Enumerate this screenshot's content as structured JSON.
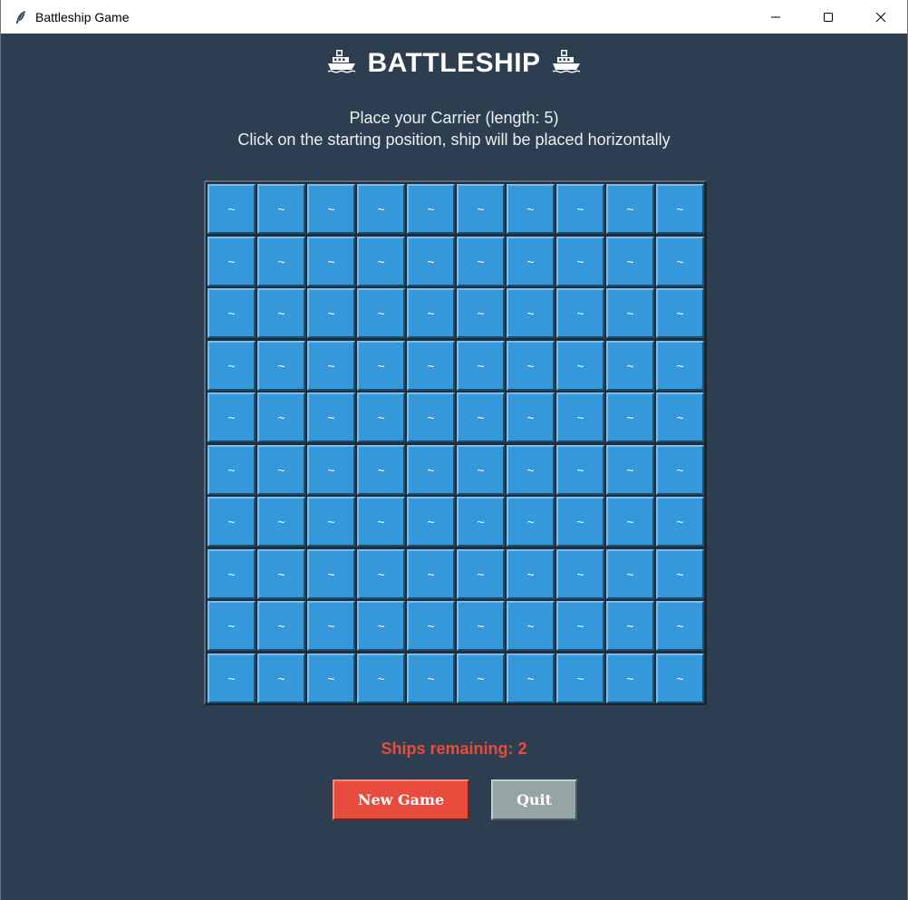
{
  "window": {
    "title": "Battleship Game"
  },
  "header": {
    "title": "BATTLESHIP",
    "left_icon": "ship-icon",
    "right_icon": "ship-icon"
  },
  "instructions": {
    "line1": "Place your Carrier (length: 5)",
    "line2": "Click on the starting position, ship will be placed horizontally"
  },
  "board": {
    "rows": 10,
    "cols": 10,
    "cell_symbol": "~"
  },
  "status": {
    "ships_remaining": "Ships remaining: 2"
  },
  "buttons": {
    "new_game": "New Game",
    "quit": "Quit"
  },
  "colors": {
    "background": "#2c3e50",
    "cell": "#3498db",
    "new_game": "#e74c3c",
    "quit": "#95a5a6",
    "status": "#e74c3c"
  }
}
